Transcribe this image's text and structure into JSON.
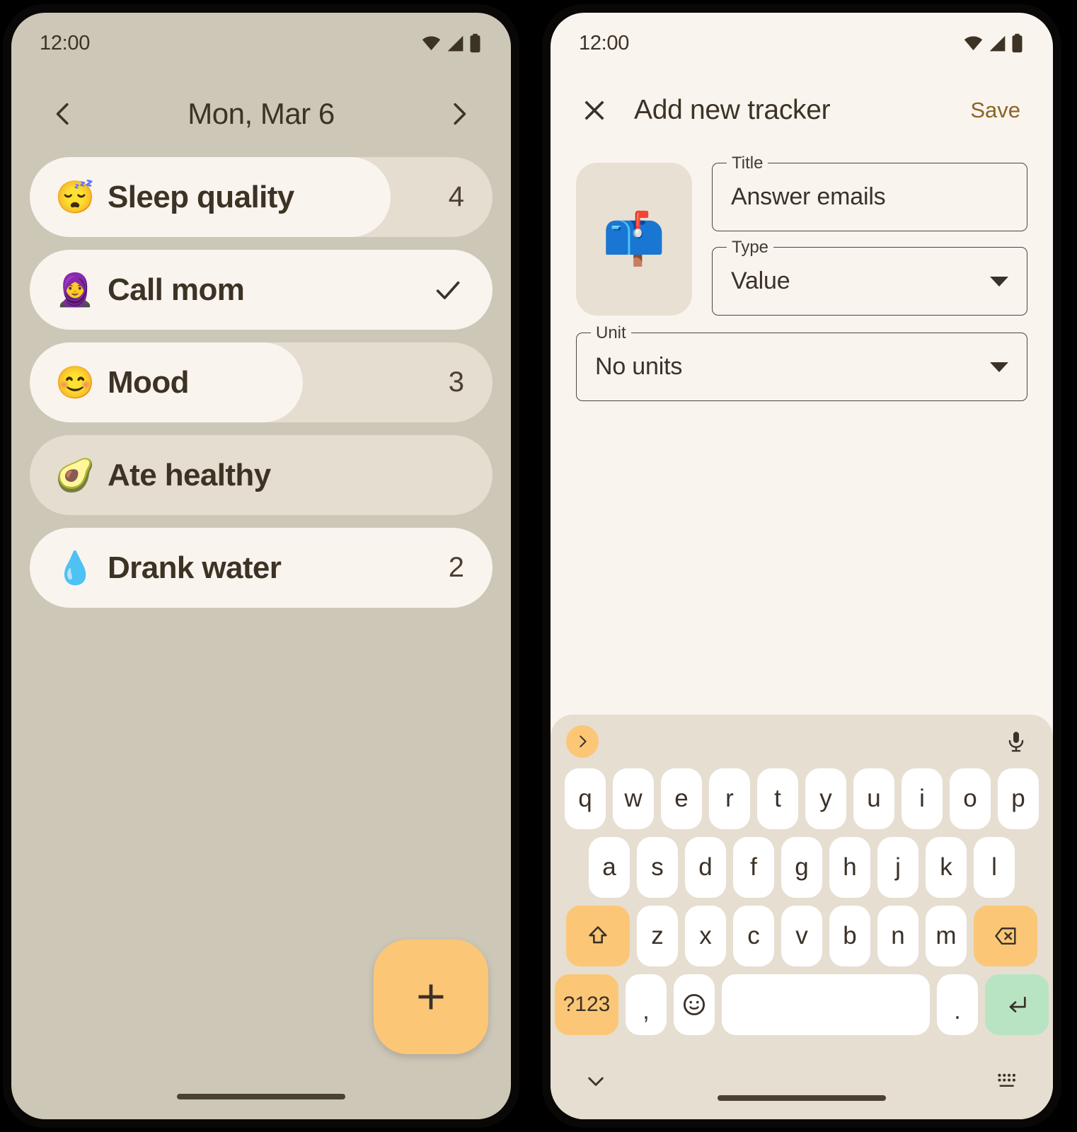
{
  "left_phone": {
    "status_bar": {
      "time": "12:00",
      "icons": [
        "wifi-icon",
        "cellular-icon",
        "battery-icon"
      ]
    },
    "header": {
      "prev_icon": "chevron-left-icon",
      "date": "Mon, Mar 6",
      "next_icon": "chevron-right-icon"
    },
    "trackers": [
      {
        "emoji": "😴",
        "emoji_name": "sleeping-face-emoji",
        "label": "Sleep quality",
        "value": "4",
        "display": "value",
        "fill_percent": 78
      },
      {
        "emoji": "🧕",
        "emoji_name": "woman-with-headscarf-emoji",
        "label": "Call mom",
        "value": "",
        "display": "check",
        "fill_percent": 100
      },
      {
        "emoji": "😊",
        "emoji_name": "smiling-face-emoji",
        "label": "Mood",
        "value": "3",
        "display": "value",
        "fill_percent": 59
      },
      {
        "emoji": "🥑",
        "emoji_name": "avocado-emoji",
        "label": "Ate healthy",
        "value": "",
        "display": "none",
        "fill_percent": 0
      },
      {
        "emoji": "💧",
        "emoji_name": "droplet-emoji",
        "label": "Drank water",
        "value": "2",
        "display": "value",
        "fill_percent": 100
      }
    ],
    "fab": {
      "icon": "plus-icon",
      "label": ""
    }
  },
  "right_phone": {
    "status_bar": {
      "time": "12:00",
      "icons": [
        "wifi-icon",
        "cellular-icon",
        "battery-icon"
      ]
    },
    "appbar": {
      "close_icon": "close-icon",
      "title": "Add new tracker",
      "save_label": "Save"
    },
    "form": {
      "emoji": "📫",
      "emoji_name": "mailbox-emoji",
      "title_field": {
        "label": "Title",
        "value": "Answer emails",
        "placeholder": "Title"
      },
      "type_field": {
        "label": "Type",
        "value": "Value",
        "placeholder": "Type"
      },
      "unit_field": {
        "label": "Unit",
        "value": "No units",
        "placeholder": "Unit"
      }
    },
    "keyboard": {
      "expand_icon": "chevron-right-icon",
      "mic_icon": "microphone-icon",
      "row1": [
        "q",
        "w",
        "e",
        "r",
        "t",
        "y",
        "u",
        "i",
        "o",
        "p"
      ],
      "row2": [
        "a",
        "s",
        "d",
        "f",
        "g",
        "h",
        "j",
        "k",
        "l"
      ],
      "row3": [
        "z",
        "x",
        "c",
        "v",
        "b",
        "n",
        "m"
      ],
      "shift_icon": "shift-icon",
      "backspace_icon": "backspace-icon",
      "symbols_label": "?123",
      "comma_label": ",",
      "emoji_key_icon": "emoji-icon",
      "space_label": "",
      "period_label": ".",
      "enter_icon": "enter-icon",
      "hide_icon": "chevron-down-icon",
      "switch_icon": "keyboard-switch-icon"
    }
  },
  "colors": {
    "accent": "#fbc777",
    "surface": "#faf4ef",
    "left_bg": "#cdc7b8",
    "track": "#e4ddd0",
    "text": "#3d3325",
    "save_text": "#8a6524",
    "enter_key": "#b9e4c4",
    "keyboard_bg": "#e6ded1"
  }
}
